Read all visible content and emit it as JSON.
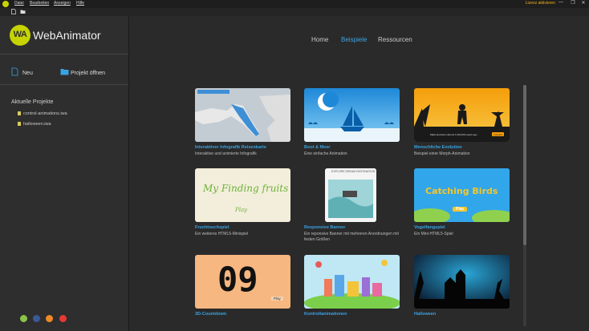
{
  "menubar": {
    "items": [
      "Datei",
      "Bearbeiten",
      "Anzeigen",
      "Hilfe"
    ],
    "license_link": "Lizenz aktivieren",
    "window_buttons": [
      "—",
      "❐",
      "✕"
    ]
  },
  "sidebar": {
    "brand": "WebAnimator",
    "logo_text": "WA",
    "new_label": "Neu",
    "open_label": "Projekt öffnen",
    "recent_title": "Aktuelle Projekte",
    "recent_files": [
      "control-animations.iwa",
      "halloween.iwa"
    ],
    "social_icons": [
      "webanimator-icon",
      "facebook-icon",
      "share-icon",
      "youtube-icon"
    ]
  },
  "nav": {
    "items": [
      "Home",
      "Beispiele",
      "Ressourcen"
    ],
    "active": "Beispiele"
  },
  "cards": [
    {
      "title": "Interaktiver Infografik Reisenkarte",
      "desc": "Interaktive und animierte Infografik",
      "img_label": "Click to jump to the map"
    },
    {
      "title": "Boot & Meer",
      "desc": "Eine einfache Animation",
      "img_label": ""
    },
    {
      "title": "Menschliche Evolution",
      "desc": "Beispiel einer Morph-Animation",
      "img_label": "Make Evolution almost 1,000,000 years ago",
      "img_button": "Forward"
    },
    {
      "title": "Fruchtsuchspiel",
      "desc": "Ein weiteres HTML5-Minispiel",
      "img_label": "My Finding fruits",
      "img_button": "Play"
    },
    {
      "title": "Responsive Banner",
      "desc": "Ein reponsive Banner mit mehreren Anordnungen mit festen Größen",
      "img_label": "EXPLORE DREAM DESTINATION"
    },
    {
      "title": "Vogelfangspiel",
      "desc": "Ein Mini-HTML5-Spiel",
      "img_label": "Catching Birds",
      "img_button": "Play"
    },
    {
      "title": "3D-Countdown",
      "desc": "",
      "img_label": "09",
      "img_button": "Play"
    },
    {
      "title": "Kontrollanimationen",
      "desc": "",
      "img_label": ""
    },
    {
      "title": "Halloween",
      "desc": "",
      "img_label": ""
    }
  ],
  "colors": {
    "accent": "#3aa3e3",
    "brand": "#c6d300",
    "license": "#f3b016"
  }
}
